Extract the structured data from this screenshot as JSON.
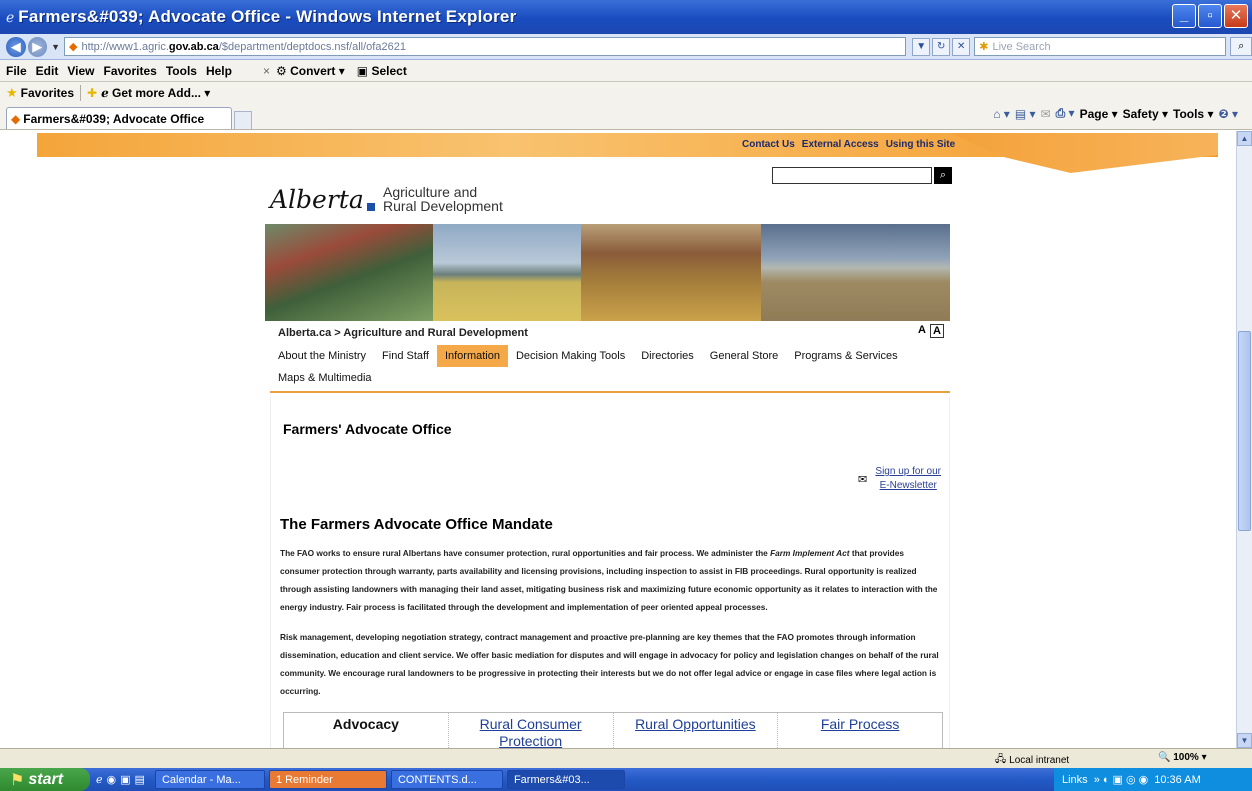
{
  "window": {
    "title": "Farmers&#039; Advocate Office - Windows Internet Explorer",
    "min": "_",
    "max": "▫",
    "close": "✕"
  },
  "addressbar": {
    "url_prefix": "http://www1.agric.",
    "url_domain": "gov.ab.ca",
    "url_suffix": "/$department/deptdocs.nsf/all/ofa2621",
    "search_placeholder": "Live Search"
  },
  "menubar": {
    "items": [
      "File",
      "Edit",
      "View",
      "Favorites",
      "Tools",
      "Help"
    ],
    "close_x": "×",
    "convert": "Convert",
    "select": "Select"
  },
  "favorites": {
    "label": "Favorites",
    "get_more": "Get more Add..."
  },
  "tabs": {
    "active_tab": "Farmers&#039; Advocate Office"
  },
  "commandbar": {
    "page": "Page",
    "safety": "Safety",
    "tools": "Tools"
  },
  "site": {
    "util_links": [
      "Contact Us",
      "External Access",
      "Using this Site"
    ],
    "logo_script": "Alberta",
    "ministry_line1": "Agriculture and",
    "ministry_line2": "Rural Development",
    "breadcrumb": "Alberta.ca > Agriculture and Rural Development",
    "textsize_small": "A",
    "textsize_large": "A",
    "nav_row1": [
      "About the Ministry",
      "Find Staff",
      "Information",
      "Decision Making Tools",
      "Directories",
      "General Store",
      "Programs & Services"
    ],
    "nav_row2": [
      "Maps & Multimedia"
    ],
    "page_title": "Farmers' Advocate Office",
    "newsletter_line1": "Sign up for our",
    "newsletter_line2": "E-Newsletter",
    "mandate_title": "The Farmers Advocate Office Mandate",
    "para1_a": "The FAO works to ensure rural Albertans have consumer protection, rural opportunities and fair process. We administer the ",
    "para1_em": "Farm Implement Act",
    "para1_b": " that provides consumer protection through warranty, parts availability and licensing provisions, including inspection to assist in FIB proceedings. Rural opportunity is realized through assisting landowners with managing their land asset, mitigating business risk and maximizing future economic opportunity as it relates to interaction with the energy industry. Fair process is facilitated through the development and implementation of peer oriented appeal processes.",
    "para2": "Risk management, developing negotiation strategy, contract management and proactive pre-planning are key themes that the FAO promotes through information dissemination, education and client service. We offer basic mediation for disputes and will engage in advocacy for policy and legislation changes on behalf of the rural community. We encourage rural landowners to be progressive in protecting their interests but we do not offer legal advice or engage in case files where legal action is occurring.",
    "content_tabs": [
      "Advocacy",
      "Rural Consumer Protection",
      "Rural Opportunities",
      "Fair Process"
    ]
  },
  "statusbar": {
    "zone": "Local intranet",
    "zoom": "100%"
  },
  "taskbar": {
    "start": "start",
    "buttons": [
      "Calendar - Ma...",
      "1 Reminder",
      "CONTENTS.d...",
      "Farmers&#03..."
    ],
    "links": "Links",
    "clock": "10:36 AM"
  },
  "colors": {
    "accent_orange": "#f5a848",
    "title_blue": "#1a4cc0",
    "link_blue": "#1f3f9a"
  }
}
